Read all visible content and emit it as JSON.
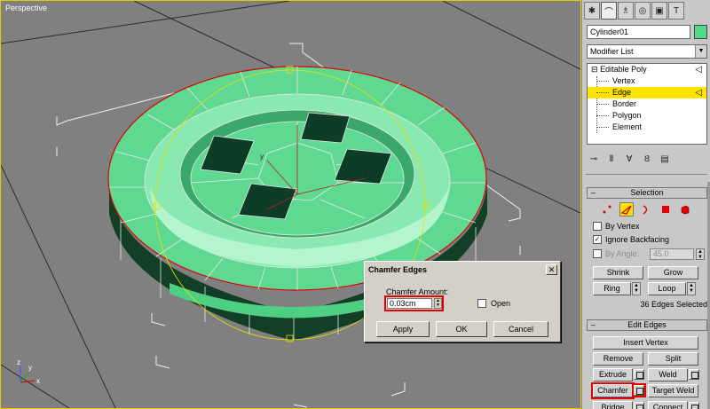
{
  "viewport": {
    "label": "Perspective",
    "axis_x": "x",
    "axis_y": "y",
    "axis_z": "z",
    "gizmo_x": "x",
    "gizmo_y": "y",
    "gizmo_z": "z"
  },
  "panel": {
    "tabs": [
      {
        "icon": "create-icon",
        "glyph": "✱"
      },
      {
        "icon": "modify-icon",
        "glyph": "⌒"
      },
      {
        "icon": "hierarchy-icon",
        "glyph": "♗"
      },
      {
        "icon": "motion-icon",
        "glyph": "◎"
      },
      {
        "icon": "display-icon",
        "glyph": "▣"
      },
      {
        "icon": "utilities-icon",
        "glyph": "T"
      }
    ],
    "object_name": "Cylinder01",
    "object_color": "#55d88a",
    "modifier_list_label": "Modifier List",
    "stack": {
      "root": "Editable Poly",
      "items": [
        "Vertex",
        "Edge",
        "Border",
        "Polygon",
        "Element"
      ],
      "selected": "Edge"
    },
    "selection": {
      "title": "Selection",
      "by_vertex_label": "By Vertex",
      "by_vertex_checked": false,
      "ignore_backfacing_label": "Ignore Backfacing",
      "ignore_backfacing_checked": true,
      "by_angle_label": "By Angle:",
      "by_angle_value": "45.0",
      "shrink_label": "Shrink",
      "grow_label": "Grow",
      "ring_label": "Ring",
      "loop_label": "Loop",
      "status": "36 Edges Selected"
    },
    "edit_edges": {
      "title": "Edit Edges",
      "insert_vertex_label": "Insert Vertex",
      "remove_label": "Remove",
      "split_label": "Split",
      "extrude_label": "Extrude",
      "weld_label": "Weld",
      "chamfer_label": "Chamfer",
      "target_weld_label": "Target Weld",
      "bridge_label": "Bridge",
      "connect_label": "Connect"
    }
  },
  "dialog": {
    "title": "Chamfer Edges",
    "amount_label": "Chamfer Amount:",
    "amount_value": "0.03cm",
    "open_label": "Open",
    "open_checked": false,
    "apply_label": "Apply",
    "ok_label": "OK",
    "cancel_label": "Cancel"
  },
  "colors": {
    "model_top": "#62dc94",
    "model_highlight": "#b4f5cf",
    "model_side": "#0f3a22",
    "selection_highlight": "#ffe400",
    "annotation_red": "#e00000"
  }
}
